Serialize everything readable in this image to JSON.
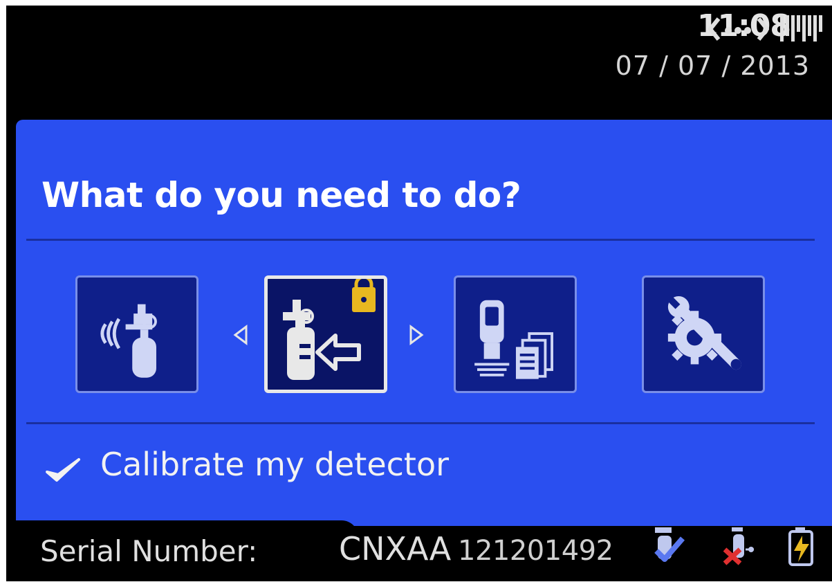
{
  "status_bar": {
    "time": "11:08",
    "date": "07 / 07 / 2013",
    "connection_icon": "connection-dots-icon",
    "signal_icon": "signal-strength-icon"
  },
  "main": {
    "title": "What do you need to do?",
    "tiles": [
      {
        "name": "wireless-detector-icon",
        "selected": false
      },
      {
        "name": "calibrate-cylinder-icon",
        "selected": true,
        "locked": true
      },
      {
        "name": "datalog-icon",
        "selected": false
      },
      {
        "name": "settings-icon",
        "selected": false
      }
    ],
    "selected_option": "Calibrate my detector"
  },
  "footer": {
    "serial_label": "Serial Number:",
    "serial_prefix": "CNXAA",
    "serial_number": "121201492",
    "status_icons": [
      "calibration-ok-icon",
      "bump-failed-icon",
      "battery-icon"
    ]
  },
  "colors": {
    "panel": "#2a4ff0",
    "tile": "#0f1f8a",
    "lock": "#e8b820",
    "fail": "#e03030"
  }
}
